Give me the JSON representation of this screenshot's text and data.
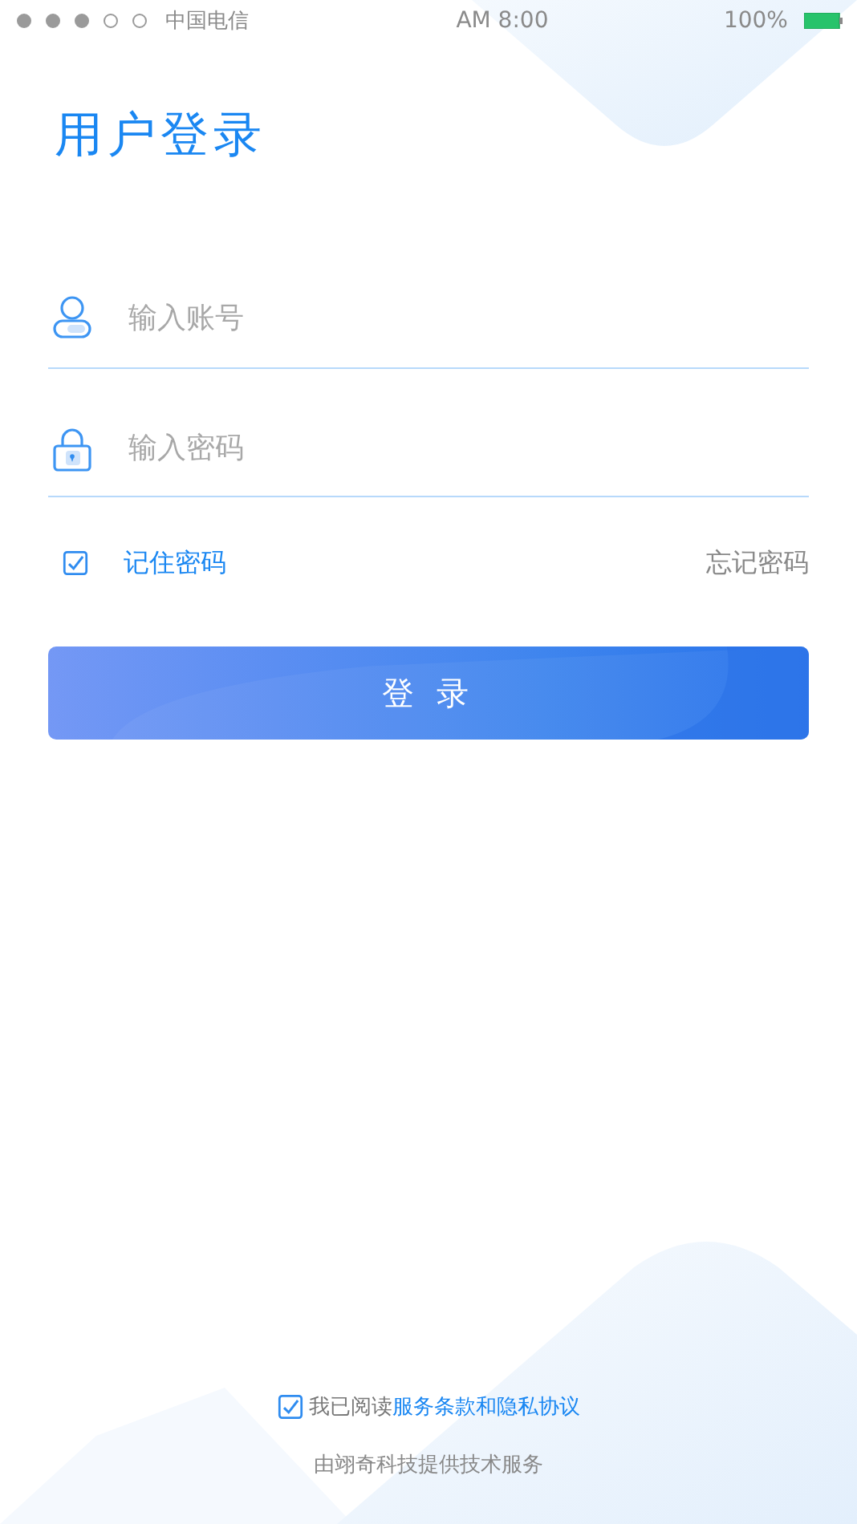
{
  "status_bar": {
    "carrier": "中国电信",
    "time": "AM 8:00",
    "battery": "100%"
  },
  "title": "用户登录",
  "fields": [
    {
      "kind": "account",
      "placeholder": "输入账号"
    },
    {
      "kind": "password",
      "placeholder": "输入密码"
    }
  ],
  "remember": {
    "label": "记住密码",
    "checked": true
  },
  "forgot": "忘记密码",
  "login_button": "登 录",
  "agreement": {
    "checked": true,
    "prefix": "我已阅读",
    "link": "服务条款和隐私协议"
  },
  "footer": "由翊奇科技提供技术服务"
}
